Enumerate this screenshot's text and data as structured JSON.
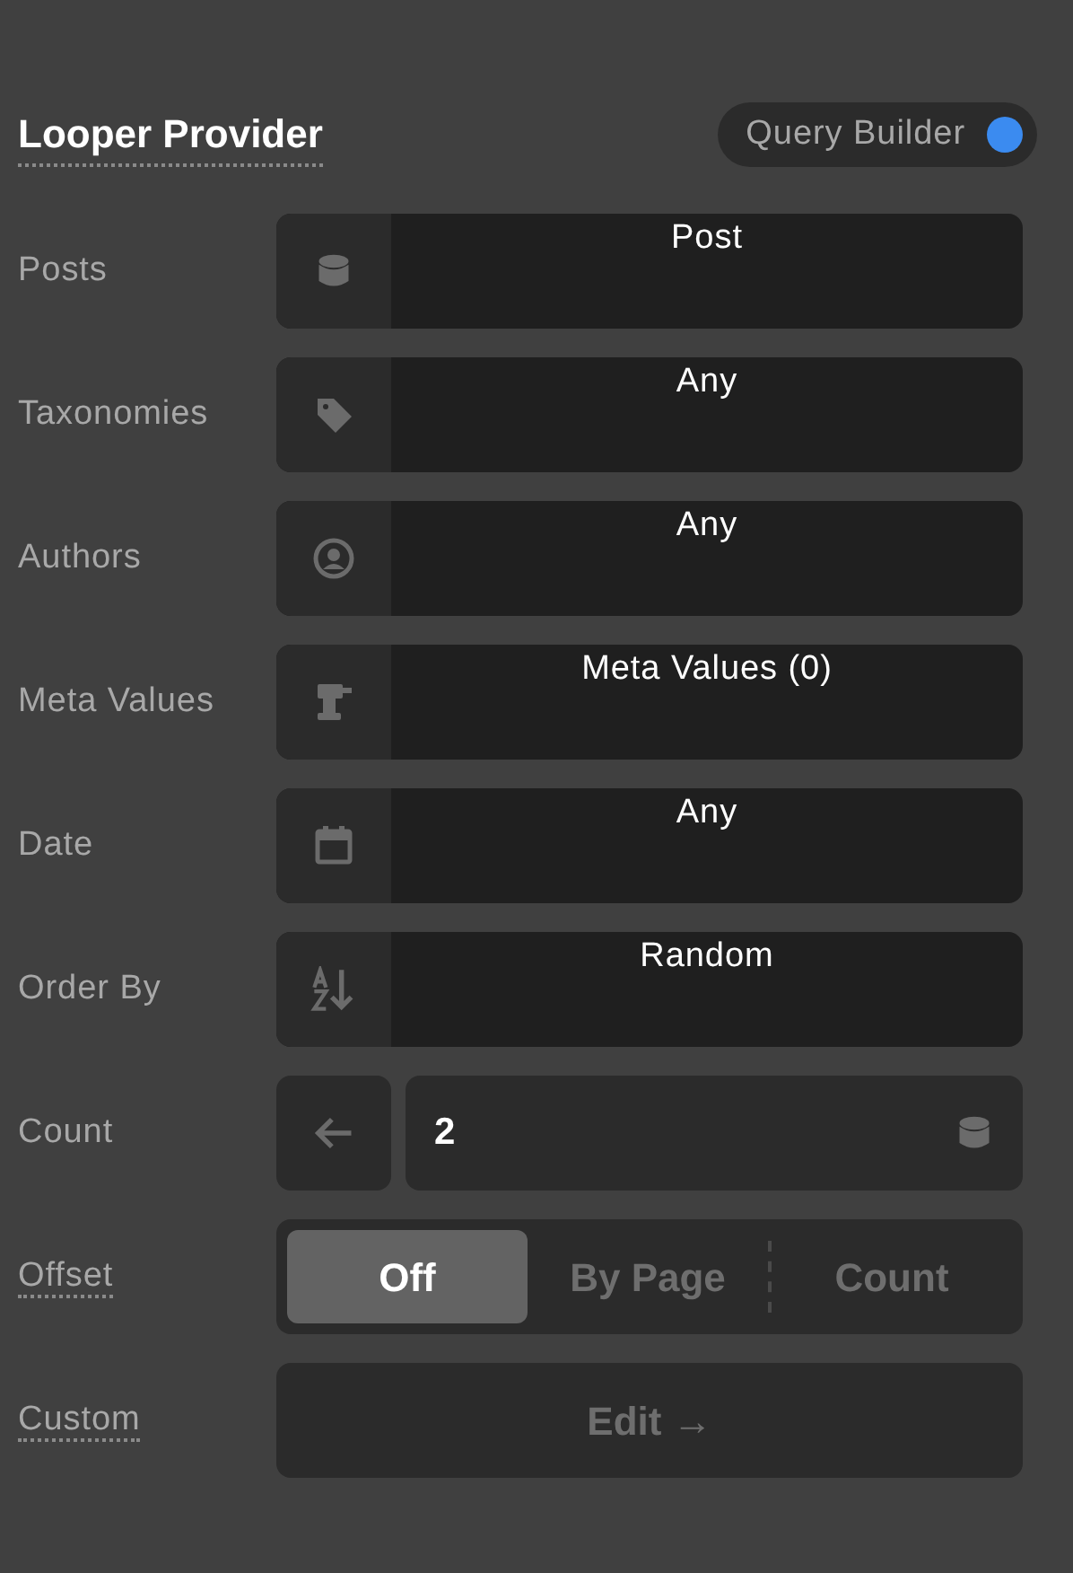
{
  "header": {
    "title": "Looper Provider",
    "title_underlined": true,
    "toggle": {
      "label": "Query Builder",
      "on": true
    }
  },
  "rows": [
    {
      "kind": "select",
      "label": "Posts",
      "underlined": false,
      "value": "Post"
    },
    {
      "kind": "select",
      "label": "Taxonomies",
      "underlined": false,
      "value": "Any"
    },
    {
      "kind": "select",
      "label": "Authors",
      "underlined": false,
      "value": "Any"
    },
    {
      "kind": "select",
      "label": "Meta Values",
      "underlined": false,
      "value": "Meta Values (0)"
    },
    {
      "kind": "select",
      "label": "Date",
      "underlined": false,
      "value": "Any"
    },
    {
      "kind": "select",
      "label": "Order By",
      "underlined": false,
      "value": "Random"
    },
    {
      "kind": "number",
      "label": "Count",
      "underlined": false,
      "value": "2"
    },
    {
      "kind": "segmented",
      "label": "Offset",
      "underlined": true,
      "options": [
        {
          "label": "Off",
          "selected": true
        },
        {
          "label": "By Page",
          "selected": false
        },
        {
          "label": "Count",
          "selected": false
        }
      ]
    },
    {
      "kind": "button",
      "label": "Custom",
      "underlined": true,
      "value": "Edit →"
    }
  ]
}
